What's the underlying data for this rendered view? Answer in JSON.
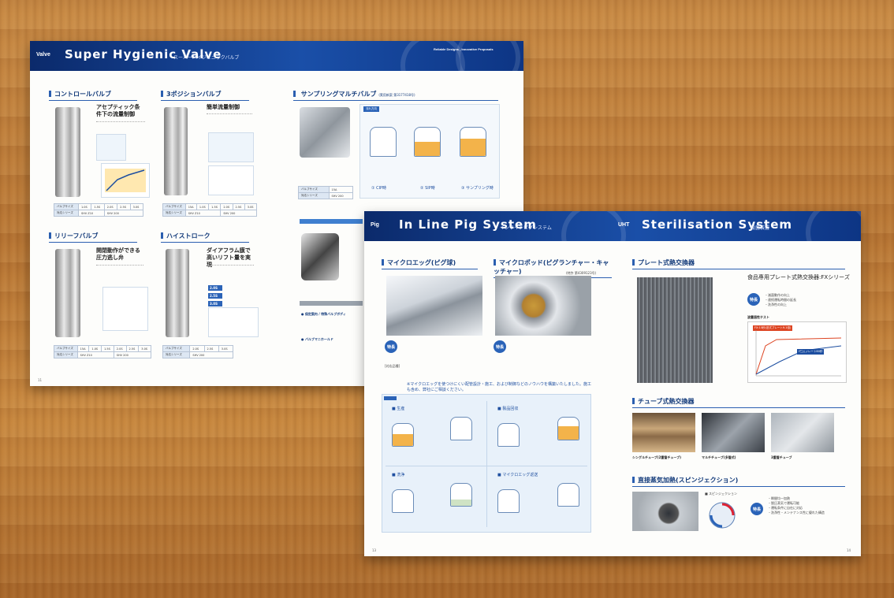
{
  "left_spread": {
    "tag": "Valve",
    "title": "Super Hygienic Valve",
    "subtitle": "スーパーハイジェニックバルブ",
    "tagline": "Reliable Designs , Innovative Proposals",
    "sections": {
      "control": {
        "title": "コントロールバルブ",
        "headline": "アセプティック条件下の流量制御"
      },
      "three_pos": {
        "title": "3ポジションバルブ",
        "headline": "簡単流量制御"
      },
      "sampling": {
        "title": "サンプリングマルチバルブ",
        "note": "(実用新案 第3177418号)"
      },
      "relief": {
        "title": "リリーフバルブ",
        "headline": "開閉動作ができる圧力逃し弁"
      },
      "highstroke": {
        "title": "ハイストローク",
        "headline": "ダイアフラム膜で高いリフト量を実現"
      }
    },
    "sampling_labels": {
      "cip": "① CIP時",
      "sip": "② SIP時",
      "sampling": "③ サンプリング時",
      "flow": "流れ方向"
    },
    "tables": {
      "control": {
        "size_label": "バルブサイズ",
        "sizes": [
          "1.0S",
          "1.5S",
          "2.0S",
          "2.5S",
          "3.0S"
        ],
        "series_label": "対応シリーズ",
        "series": [
          "SHV Z10",
          "SHV 200"
        ]
      },
      "three_pos": {
        "size_label": "バルブサイズ",
        "sizes": [
          "15A",
          "1.0S",
          "1.5S",
          "2.0S",
          "2.5S",
          "3.0S"
        ],
        "series_label": "対応シリーズ",
        "series": [
          "SHV Z10",
          "SHV 200"
        ]
      },
      "sampling": {
        "size_label": "バルブサイズ",
        "size": "15A",
        "series_label": "対応シリーズ",
        "series": "SHV 200"
      },
      "relief": {
        "size_label": "バルブサイズ",
        "sizes": [
          "15A",
          "1.0S",
          "1.5S",
          "2.0S",
          "2.5S",
          "3.0S"
        ],
        "series_label": "対応シリーズ",
        "series": [
          "SHV Z10",
          "SHV 200"
        ]
      },
      "highstroke": {
        "size_label": "バルブサイズ",
        "sizes": [
          "2.0S",
          "2.5S",
          "3.0S"
        ],
        "series_label": "対応シリーズ",
        "series": "SHV 200"
      }
    },
    "highstroke_sizes": [
      "2.0S",
      "2.5S",
      "3.0S"
    ],
    "extra_sections": [
      "●  保定案内 / 特殊バルブボディ",
      "●  バルブマニホールド"
    ],
    "page_number": "11"
  },
  "right_spread": {
    "left_header": {
      "tag": "Pig",
      "title": "In Line Pig System",
      "subtitle": "インラインピグシステム"
    },
    "right_header": {
      "tag": "UHT",
      "title": "Sterilisation System",
      "subtitle": "殺菌装置"
    },
    "pig": {
      "micro_egg": "マイクロエッグ(ピグ球)",
      "micro_pod": "マイクロポッド(ピグランチャー・キャッチャー)",
      "micro_pod_note": "(特許 第4309123号)",
      "feature_label": "特長",
      "notice": "※マイクロエッグを使つけにくい配管設計・施工、および制御などのノウハウを構築いたしました。施工も含め、弊社にご相談ください。",
      "panels": [
        "■  生産",
        "■  製品回収",
        "■  洗浄",
        "■  マイクロエッグ返送"
      ],
      "spec_label": "[対応品種]"
    },
    "uht": {
      "plate_title": "プレート式熱交換器",
      "plate_product": "食品専用プレート式熱交換器:FXシリーズ",
      "feature_label": "特長",
      "plate_features": [
        "・滅菌動作の向上",
        "・連続運転時間の延長",
        "・洗浄性の向上"
      ],
      "chart_title": "波量過性テスト",
      "chart_legend": [
        "FX:15秒(旧式プレート9.1倍)",
        "(旧式プレート60秒"
      ],
      "tube_title": "チューブ式熱交換器",
      "tube_captions": [
        "シングルチューブ(2重管チューブ)",
        "マルチチューブ(多管式)",
        "3重管チューブ"
      ],
      "direct_title": "直接蒸気加熱(スピンジェクション)",
      "direct_label": "■  スピンジェクション",
      "direct_features": [
        "・瞬間均一加熱",
        "・脱圧蒸気で運転可能",
        "・運転条件に自在に対応",
        "・洗浄性・メンテナンス性に優れた構造"
      ]
    },
    "page_numbers": [
      "13",
      "14"
    ]
  }
}
